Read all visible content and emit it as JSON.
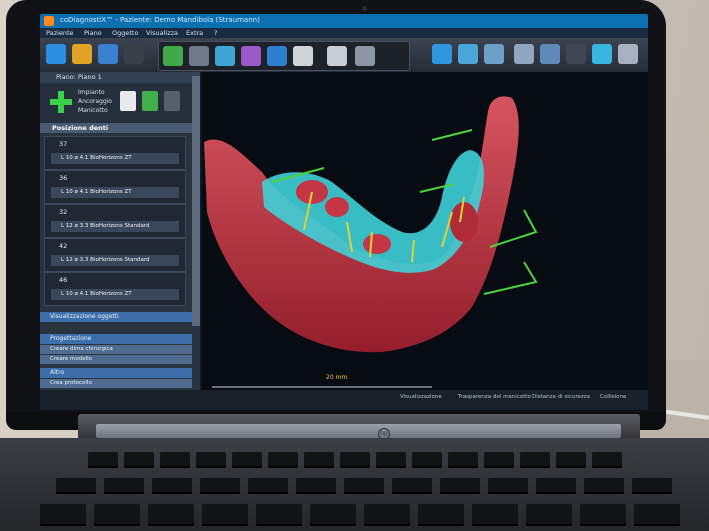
{
  "scene": {
    "description_free": true,
    "laptop_brand_text": "hp",
    "logo_text": "hp"
  },
  "app": {
    "title": "coDiagnostiX™ - Paziente: Demo Mandibola (Straumann)",
    "menu": [
      "Paziente",
      "Piano",
      "Oggetto",
      "Visualizza",
      "Extra",
      "?"
    ],
    "panel_title": "Piano: Piano 1",
    "actions": [
      "Impianto",
      "Ancoraggio",
      "Manicotto"
    ],
    "section_title": "Posizione denti",
    "teeth": [
      {
        "number": "37",
        "detail": "L 10  ø 4.1  BioHorizons ZT"
      },
      {
        "number": "36",
        "detail": "L 10  ø 4.1  BioHorizons ZT"
      },
      {
        "number": "32",
        "detail": "L 12  ø 3.3  BioHorizons Standard"
      },
      {
        "number": "42",
        "detail": "L 12  ø 3.3  BioHorizons Standard"
      },
      {
        "number": "46",
        "detail": "L 10  ø 4.1  BioHorizons ZT"
      }
    ],
    "lower_sections": [
      {
        "header": "Visualizzazione oggetti",
        "rows": []
      },
      {
        "header": "Progettazione",
        "rows": [
          "Creare dima chirurgica",
          "Creare modello"
        ]
      },
      {
        "header": "Altro",
        "rows": [
          "Crea protocollo"
        ]
      }
    ],
    "ruler_label": "20 mm",
    "status": [
      "Visualizzazione",
      "Trasparenza del manicotto",
      "Distanza di sicurezza",
      "Collisione"
    ]
  },
  "colors": {
    "bone": "#c8313f",
    "bone_light": "#e05863",
    "scan": "#3fd0d8",
    "implant_axis": "#d9d23a",
    "guide_arrow": "#4dd23e",
    "accent": "#0c6fb0"
  }
}
